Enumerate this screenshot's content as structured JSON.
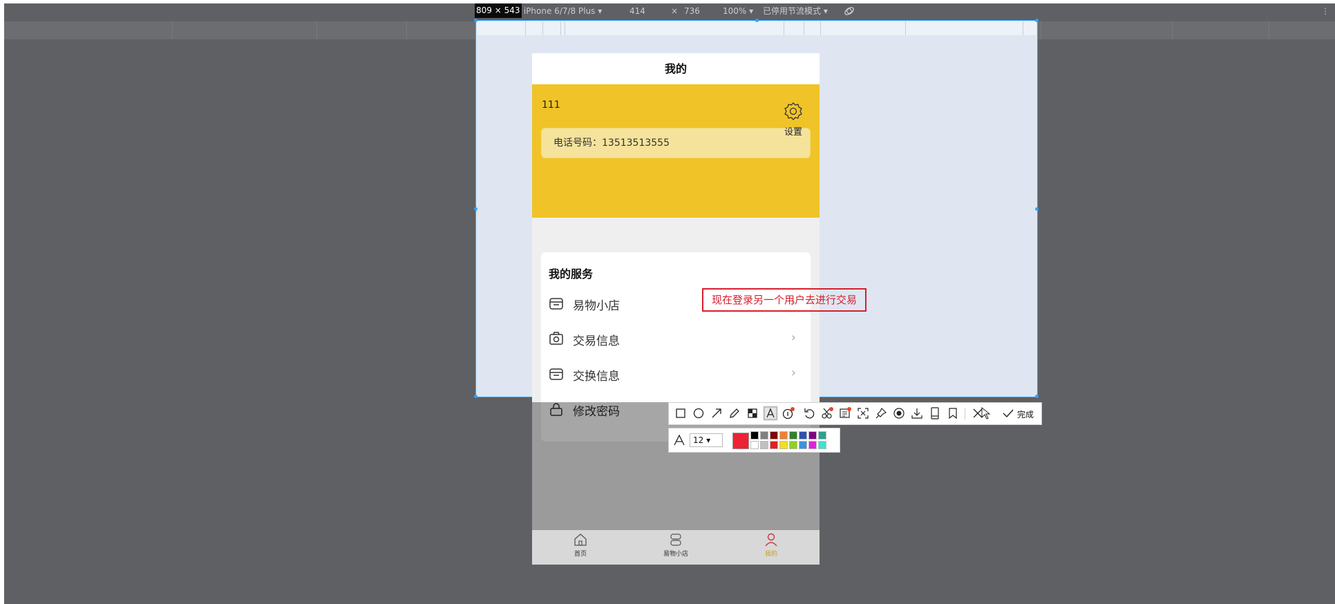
{
  "devtools": {
    "size_badge": "809 × 543",
    "device": "尺寸: iPhone 6/7/8 Plus ▾",
    "width": "414",
    "times": "×",
    "height": "736",
    "zoom": "100% ▾",
    "throttle": "已停用节流模式 ▾",
    "more": "⋮"
  },
  "phone": {
    "header_title": "我的",
    "username": "111",
    "phone_number": "电话号码：13513513555",
    "settings_label": "设置",
    "services_title": "我的服务",
    "services": [
      {
        "label": "易物小店",
        "icon": "shop-icon",
        "chevron": "›"
      },
      {
        "label": "交易信息",
        "icon": "camera-icon",
        "chevron": "›"
      },
      {
        "label": "交换信息",
        "icon": "shop-icon",
        "chevron": "›"
      },
      {
        "label": "修改密码",
        "icon": "lock-icon",
        "chevron": ""
      }
    ],
    "tabs": [
      {
        "label": "首页",
        "icon": "home-icon"
      },
      {
        "label": "易物小店",
        "icon": "exchange-icon"
      },
      {
        "label": "我的",
        "icon": "user-icon"
      }
    ]
  },
  "annotation_text": "现在登录另一个用户去进行交易",
  "capture_toolbar": {
    "tools": [
      "rectangle-icon",
      "ellipse-icon",
      "arrow-icon",
      "pencil-icon",
      "mosaic-icon",
      "text-icon",
      "number-icon",
      "undo-icon",
      "cutout-icon",
      "ocr-icon",
      "scroll-capture-icon",
      "pin-icon",
      "record-icon",
      "download-icon",
      "long-screenshot-icon",
      "bookmark-icon",
      "close-icon",
      "done-check-icon"
    ],
    "done_label": "完成",
    "font_size": "12 ▾",
    "current_color": "#ee2233",
    "swatches_top": [
      "#000000",
      "#808080",
      "#800000",
      "#f08030",
      "#308030",
      "#3050b0",
      "#800080",
      "#30a090"
    ],
    "swatches_bottom": [
      "#ffffff",
      "#c0c0c0",
      "#e02020",
      "#f0e020",
      "#90d020",
      "#4090e0",
      "#e020e0",
      "#40e0d0"
    ]
  }
}
